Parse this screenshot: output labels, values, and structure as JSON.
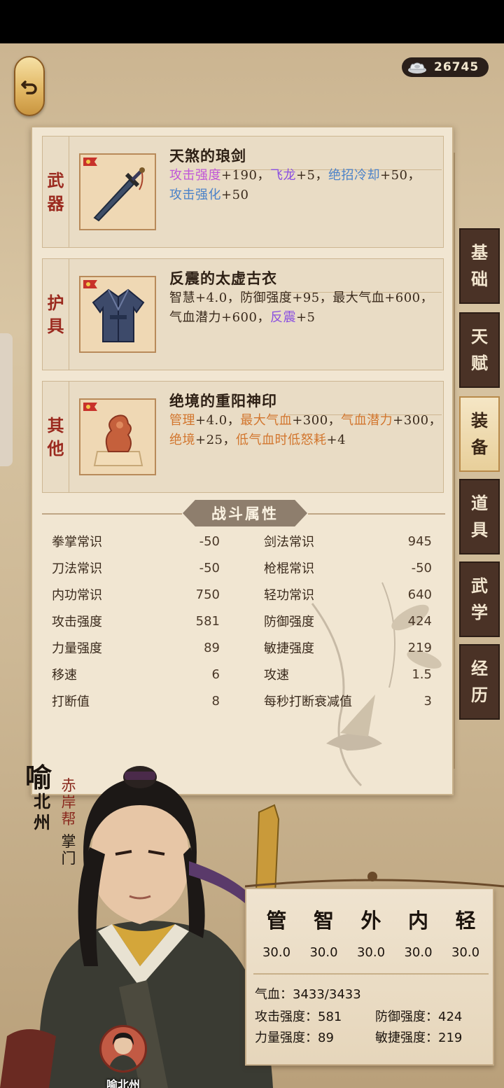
{
  "currency": {
    "amount": "26745",
    "icon": "silver-ingot-icon"
  },
  "equipment": [
    {
      "type": [
        "武",
        "器"
      ],
      "name": "天煞的琅剑",
      "icon": "sword-icon",
      "stats": [
        {
          "text": "攻击强度",
          "color": "#c056d8"
        },
        {
          "text": "+190，",
          "color": "#3a2a1c"
        },
        {
          "text": "飞龙",
          "color": "#8a4fe0"
        },
        {
          "text": "+5，",
          "color": "#3a2a1c"
        },
        {
          "text": "绝招冷却",
          "color": "#4b82c9"
        },
        {
          "text": "+50，",
          "color": "#3a2a1c"
        },
        {
          "text": "攻击强化",
          "color": "#4b82c9"
        },
        {
          "text": "+50",
          "color": "#3a2a1c"
        }
      ]
    },
    {
      "type": [
        "护",
        "具"
      ],
      "name": "反震的太虚古衣",
      "icon": "robe-icon",
      "stats": [
        {
          "text": "智慧+4.0，防御强度+95，最大气血+600，气血潜力+600，",
          "color": "#3a2a1c"
        },
        {
          "text": "反震",
          "color": "#8a4fe0"
        },
        {
          "text": "+5",
          "color": "#3a2a1c"
        }
      ]
    },
    {
      "type": [
        "其",
        "他"
      ],
      "name": "绝境的重阳神印",
      "icon": "seal-icon",
      "stats": [
        {
          "text": "管理",
          "color": "#d2762e"
        },
        {
          "text": "+4.0，",
          "color": "#3a2a1c"
        },
        {
          "text": "最大气血",
          "color": "#d2762e"
        },
        {
          "text": "+300，",
          "color": "#3a2a1c"
        },
        {
          "text": "气血潜力",
          "color": "#d2762e"
        },
        {
          "text": "+300，",
          "color": "#3a2a1c"
        },
        {
          "text": "绝境",
          "color": "#d2762e"
        },
        {
          "text": "+25，",
          "color": "#3a2a1c"
        },
        {
          "text": "低气血时低怒耗",
          "color": "#d2762e"
        },
        {
          "text": "+4",
          "color": "#3a2a1c"
        }
      ]
    }
  ],
  "battle": {
    "title": "战斗属性",
    "left": [
      {
        "label": "拳掌常识",
        "value": "-50"
      },
      {
        "label": "刀法常识",
        "value": "-50"
      },
      {
        "label": "内功常识",
        "value": "750"
      },
      {
        "label": "攻击强度",
        "value": "581"
      },
      {
        "label": "力量强度",
        "value": "89"
      },
      {
        "label": "移速",
        "value": "6"
      },
      {
        "label": "打断值",
        "value": "8"
      }
    ],
    "right": [
      {
        "label": "剑法常识",
        "value": "945"
      },
      {
        "label": "枪棍常识",
        "value": "-50"
      },
      {
        "label": "轻功常识",
        "value": "640"
      },
      {
        "label": "防御强度",
        "value": "424"
      },
      {
        "label": "敏捷强度",
        "value": "219"
      },
      {
        "label": "攻速",
        "value": "1.5"
      },
      {
        "label": "每秒打断衰减值",
        "value": "3"
      }
    ]
  },
  "tabs": [
    {
      "label": [
        "基",
        "础"
      ],
      "active": false
    },
    {
      "label": [
        "天",
        "赋"
      ],
      "active": false
    },
    {
      "label": [
        "装",
        "备"
      ],
      "active": true
    },
    {
      "label": [
        "道",
        "具"
      ],
      "active": false
    },
    {
      "label": [
        "武",
        "学"
      ],
      "active": false
    },
    {
      "label": [
        "经",
        "历"
      ],
      "active": false
    }
  ],
  "character": {
    "surname": "喻",
    "given": "北州",
    "sect": "赤岸帮",
    "title": "掌门",
    "avatar_label": "喻北州"
  },
  "card": {
    "attr_heads": [
      "管",
      "智",
      "外",
      "内",
      "轻"
    ],
    "attr_vals": [
      "30.0",
      "30.0",
      "30.0",
      "30.0",
      "30.0"
    ],
    "hp_label": "气血：",
    "hp_value": "3433/3433",
    "atk_label": "攻击强度：",
    "atk_value": "581",
    "def_label": "防御强度：",
    "def_value": "424",
    "str_label": "力量强度：",
    "str_value": "89",
    "agi_label": "敏捷强度：",
    "agi_value": "219"
  }
}
